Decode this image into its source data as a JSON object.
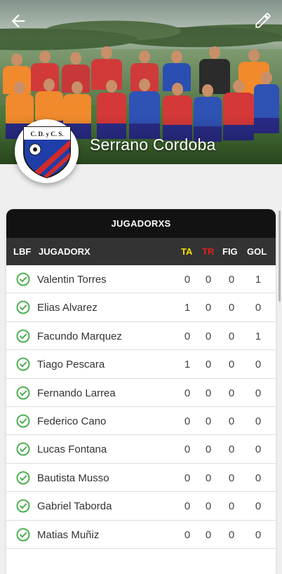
{
  "team": {
    "name": "Serrano Cordoba",
    "badge_text": "C. D. y C. S."
  },
  "toolbar": {
    "back_icon": "arrow-left-icon",
    "edit_icon": "pencil-icon"
  },
  "table": {
    "title": "JUGADORXS",
    "columns": {
      "lbf": "LBF",
      "player": "JUGADORX",
      "ta": "TA",
      "tr": "TR",
      "fig": "FIG",
      "gol": "GOL"
    },
    "column_colors": {
      "ta": "#f5e000",
      "tr": "#e02020",
      "default": "#ffffff"
    },
    "rows": [
      {
        "name": "Valentin Torres",
        "ta": "0",
        "tr": "0",
        "fig": "0",
        "gol": "1"
      },
      {
        "name": "Elias Alvarez",
        "ta": "1",
        "tr": "0",
        "fig": "0",
        "gol": "0"
      },
      {
        "name": "Facundo Marquez",
        "ta": "0",
        "tr": "0",
        "fig": "0",
        "gol": "1"
      },
      {
        "name": "Tiago Pescara",
        "ta": "1",
        "tr": "0",
        "fig": "0",
        "gol": "0"
      },
      {
        "name": "Fernando Larrea",
        "ta": "0",
        "tr": "0",
        "fig": "0",
        "gol": "0"
      },
      {
        "name": "Federico Cano",
        "ta": "0",
        "tr": "0",
        "fig": "0",
        "gol": "0"
      },
      {
        "name": "Lucas Fontana",
        "ta": "0",
        "tr": "0",
        "fig": "0",
        "gol": "0"
      },
      {
        "name": "Bautista Musso",
        "ta": "0",
        "tr": "0",
        "fig": "0",
        "gol": "0"
      },
      {
        "name": "Gabriel Taborda",
        "ta": "0",
        "tr": "0",
        "fig": "0",
        "gol": "0"
      },
      {
        "name": "Matias Muñiz",
        "ta": "0",
        "tr": "0",
        "fig": "0",
        "gol": "0"
      }
    ],
    "check_color": "#4caf50"
  }
}
